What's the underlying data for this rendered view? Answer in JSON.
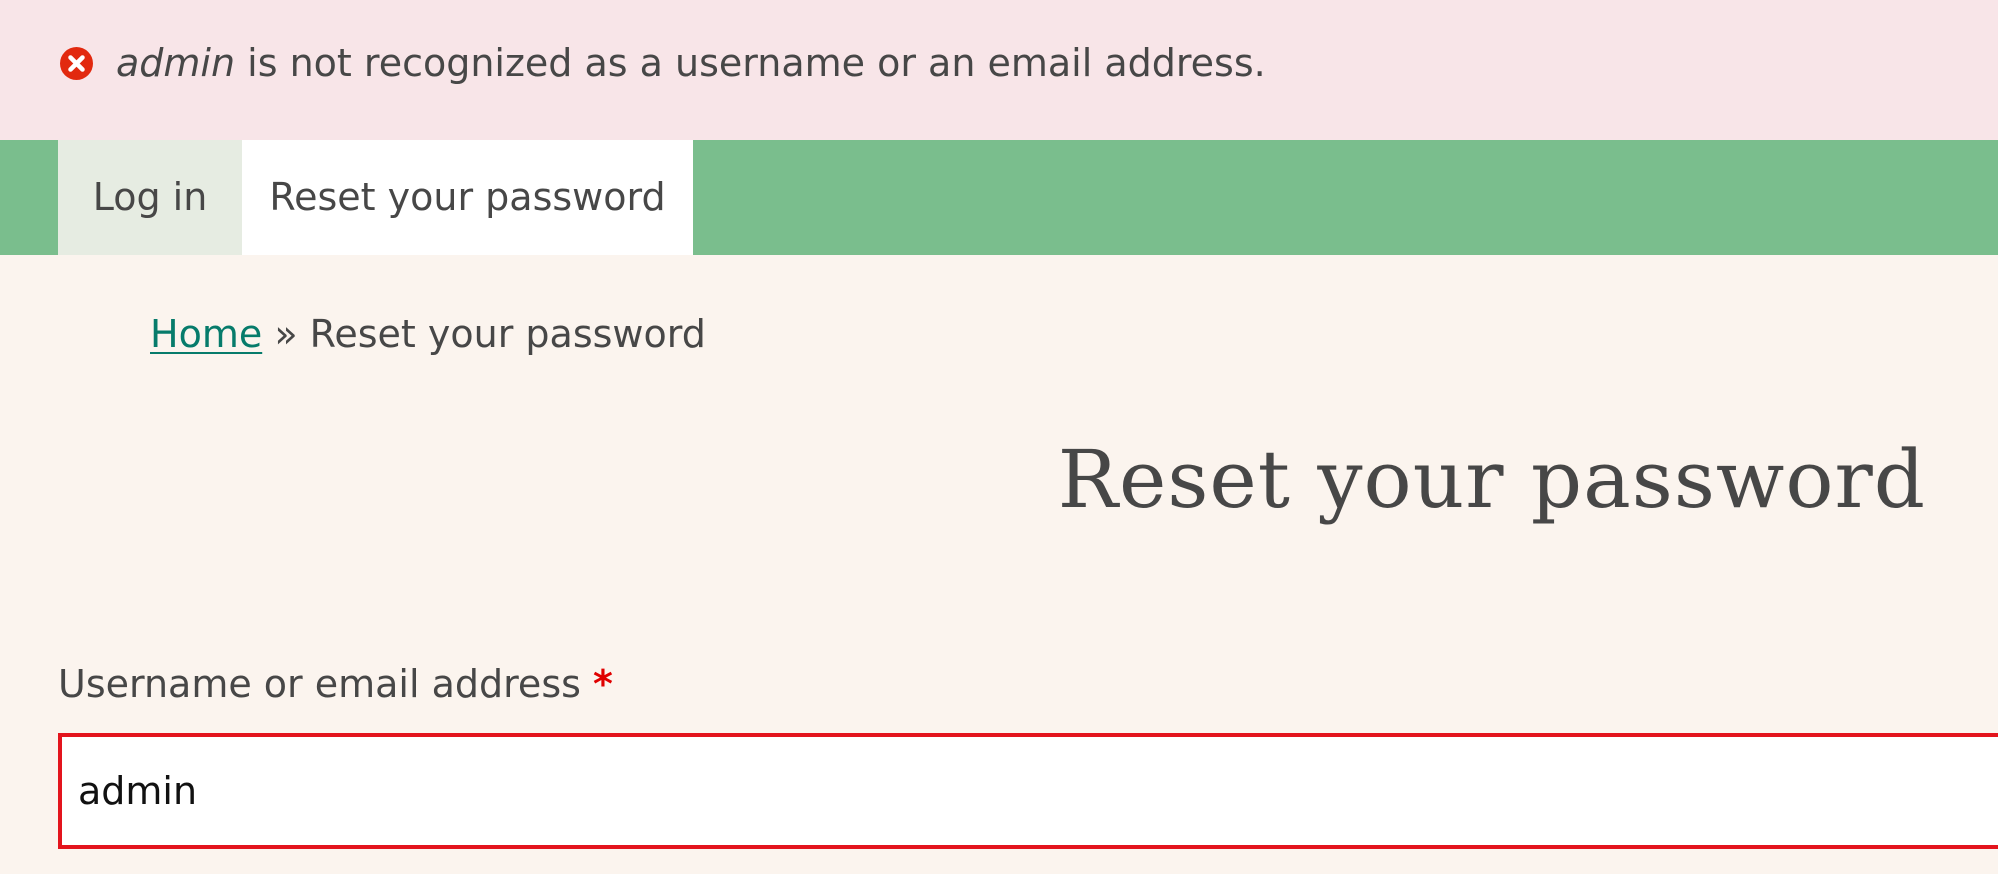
{
  "messages": {
    "error": {
      "username": "admin",
      "text": " is not recognized as a username or an email address.",
      "icon": "error-circle-icon",
      "color": "#e2290f",
      "background": "#f8e5e8"
    }
  },
  "tabs": [
    {
      "label": "Log in",
      "active": false
    },
    {
      "label": "Reset your password",
      "active": true
    }
  ],
  "tabbar_color": "#7abe8d",
  "breadcrumb": {
    "home_label": "Home",
    "separator": "»",
    "current": "Reset your password",
    "link_color": "#067b6b"
  },
  "page_title": "Reset your password",
  "form": {
    "username_label": "Username or email address",
    "required_marker": "*",
    "username_value": "admin",
    "error_border_color": "#e3141d"
  }
}
